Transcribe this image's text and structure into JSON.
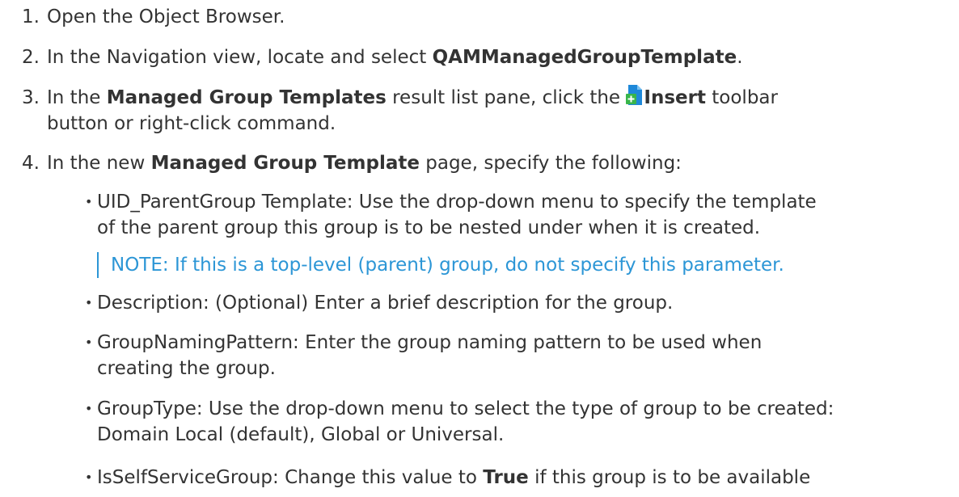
{
  "colors": {
    "text": "#333333",
    "note_accent": "#2c96d6",
    "icon_blue": "#1e88d9",
    "icon_green": "#39b54a"
  },
  "steps": [
    {
      "number": "1.",
      "text": "Open the Object Browser."
    },
    {
      "number": "2.",
      "text_before": "In the Navigation view, locate and select ",
      "bold": "QAMManagedGroupTemplate",
      "text_after": "."
    },
    {
      "number": "3.",
      "text_before": "In the ",
      "bold_pane": "Managed Group Templates",
      "text_mid": " result list pane, click the ",
      "icon": "insert-icon",
      "bold_insert": "Insert",
      "text_after": " toolbar",
      "line2": "button or right-click command."
    },
    {
      "number": "4.",
      "text_before": "In the new ",
      "bold": "Managed Group Template",
      "text_after": " page, specify the following:"
    }
  ],
  "bullets": [
    {
      "symbol": "•",
      "line1": "UID_ParentGroup Template: Use the drop-down menu to specify the template",
      "line2": "of the parent group this group is to be nested under when it is created."
    },
    {
      "symbol": "•",
      "line1": "Description: (Optional) Enter a brief description for the group."
    },
    {
      "symbol": "•",
      "line1": "GroupNamingPattern: Enter the group naming pattern to be used when",
      "line2": "creating the group."
    },
    {
      "symbol": "•",
      "line1": "GroupType: Use the drop-down menu to select the type of group to be created:",
      "line2": "Domain Local (default), Global or Universal."
    },
    {
      "symbol": "•",
      "text_before": "IsSelfServiceGroup: Change this value to ",
      "bold": "True",
      "text_after": " if this group is to be available"
    }
  ],
  "note": {
    "label": "NOTE:",
    "text": " If this is a top-level (parent) group, do not specify this parameter."
  }
}
